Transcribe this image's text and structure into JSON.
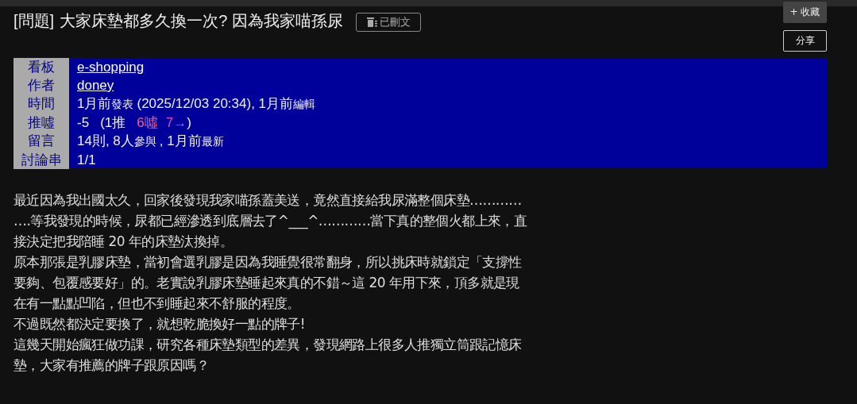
{
  "title": {
    "tag": "[問題]",
    "text": "大家床墊都多久換一次? 因為我家喵孫尿"
  },
  "status_button": {
    "label": "已刪文"
  },
  "actions": [
    {
      "label": "+ 收藏",
      "kind": "filled"
    },
    {
      "label": "分享",
      "kind": "outline"
    }
  ],
  "meta": [
    {
      "label": "看板",
      "value": [
        {
          "text": "e-shopping",
          "kind": "link"
        }
      ]
    },
    {
      "label": "作者",
      "value": [
        {
          "text": "doney",
          "kind": "link"
        }
      ]
    },
    {
      "label": "時間",
      "value": [
        {
          "text": "1月前",
          "kind": "normal"
        },
        {
          "text": "發表",
          "kind": "small"
        },
        {
          "text": "(2025/12/03 20:34), 1月前",
          "kind": "normal"
        },
        {
          "text": "編輯",
          "kind": "small"
        }
      ]
    },
    {
      "label": "推噓",
      "value": [
        {
          "text": "-5",
          "kind": "normal"
        },
        {
          "text": "(1推",
          "kind": "normal"
        },
        {
          "text": "6噓",
          "kind": "boo"
        },
        {
          "text": "7→",
          "kind": "arrow"
        },
        {
          "text": ")",
          "kind": "normal"
        }
      ]
    },
    {
      "label": "留言",
      "value": [
        {
          "text": "14則, 8人",
          "kind": "normal"
        },
        {
          "text": "參與",
          "kind": "small"
        },
        {
          "text": ", 1月前",
          "kind": "normal"
        },
        {
          "text": "最新",
          "kind": "small"
        }
      ]
    },
    {
      "label": "討論串",
      "value": [
        {
          "text": "1/1",
          "kind": "normal"
        }
      ]
    }
  ],
  "body_lines": [
    "最近因為我出國太久，回家後發現我家喵孫蓋美送，竟然直接給我尿滿整個床墊…………",
    "….等我發現的時候，尿都已經滲透到底層去了^___^…………當下真的整個火都上來，直",
    "接決定把我陪睡 20 年的床墊汰換掉。",
    "原本那張是乳膠床墊，當初會選乳膠是因為我睡覺很常翻身，所以挑床時就鎖定「支撐性",
    "要夠、包覆感要好」的。老實說乳膠床墊睡起來真的不錯～這 20 年用下來，頂多就是現",
    "在有一點點凹陷，但也不到睡起來不舒服的程度。",
    "不過既然都決定要換了，就想乾脆換好一點的牌子!",
    "這幾天開始瘋狂做功課，研究各種床墊類型的差異，發現網路上很多人推獨立筒跟記憶床",
    "墊，大家有推薦的牌子跟原因嗎？"
  ]
}
